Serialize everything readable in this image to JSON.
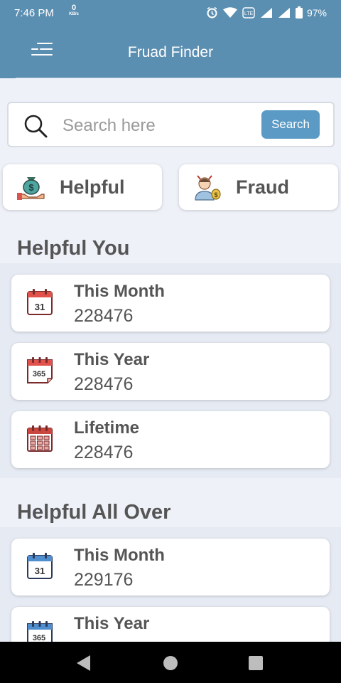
{
  "status_bar": {
    "time": "7:46 PM",
    "net_speed_value": "0",
    "net_speed_unit": "KB/s",
    "battery": "97%",
    "icons": [
      "alarm-icon",
      "wifi-icon",
      "volte-icon",
      "signal-icon",
      "signal-icon",
      "battery-icon"
    ]
  },
  "app_bar": {
    "title": "Fruad Finder",
    "menu_icon": "menu-icon"
  },
  "search": {
    "placeholder": "Search here",
    "value": "",
    "button_label": "Search"
  },
  "categories": [
    {
      "label": "Helpful",
      "icon": "money-bag-hand-icon"
    },
    {
      "label": "Fraud",
      "icon": "fraud-person-icon"
    }
  ],
  "sections": [
    {
      "title": "Helpful You",
      "items": [
        {
          "title": "This Month",
          "value": "228476",
          "icon": "calendar-31-icon"
        },
        {
          "title": "This Year",
          "value": "228476",
          "icon": "calendar-365-icon"
        },
        {
          "title": "Lifetime",
          "value": "228476",
          "icon": "calendar-grid-icon"
        }
      ]
    },
    {
      "title": "Helpful All Over",
      "items": [
        {
          "title": "This Month",
          "value": "229176",
          "icon": "calendar-31-icon"
        },
        {
          "title": "This Year",
          "value": "",
          "icon": "calendar-365-icon"
        }
      ]
    }
  ],
  "colors": {
    "primary": "#5b8fb2",
    "search_button": "#5b9ac4",
    "background": "#eef1f8",
    "text": "#555555"
  }
}
